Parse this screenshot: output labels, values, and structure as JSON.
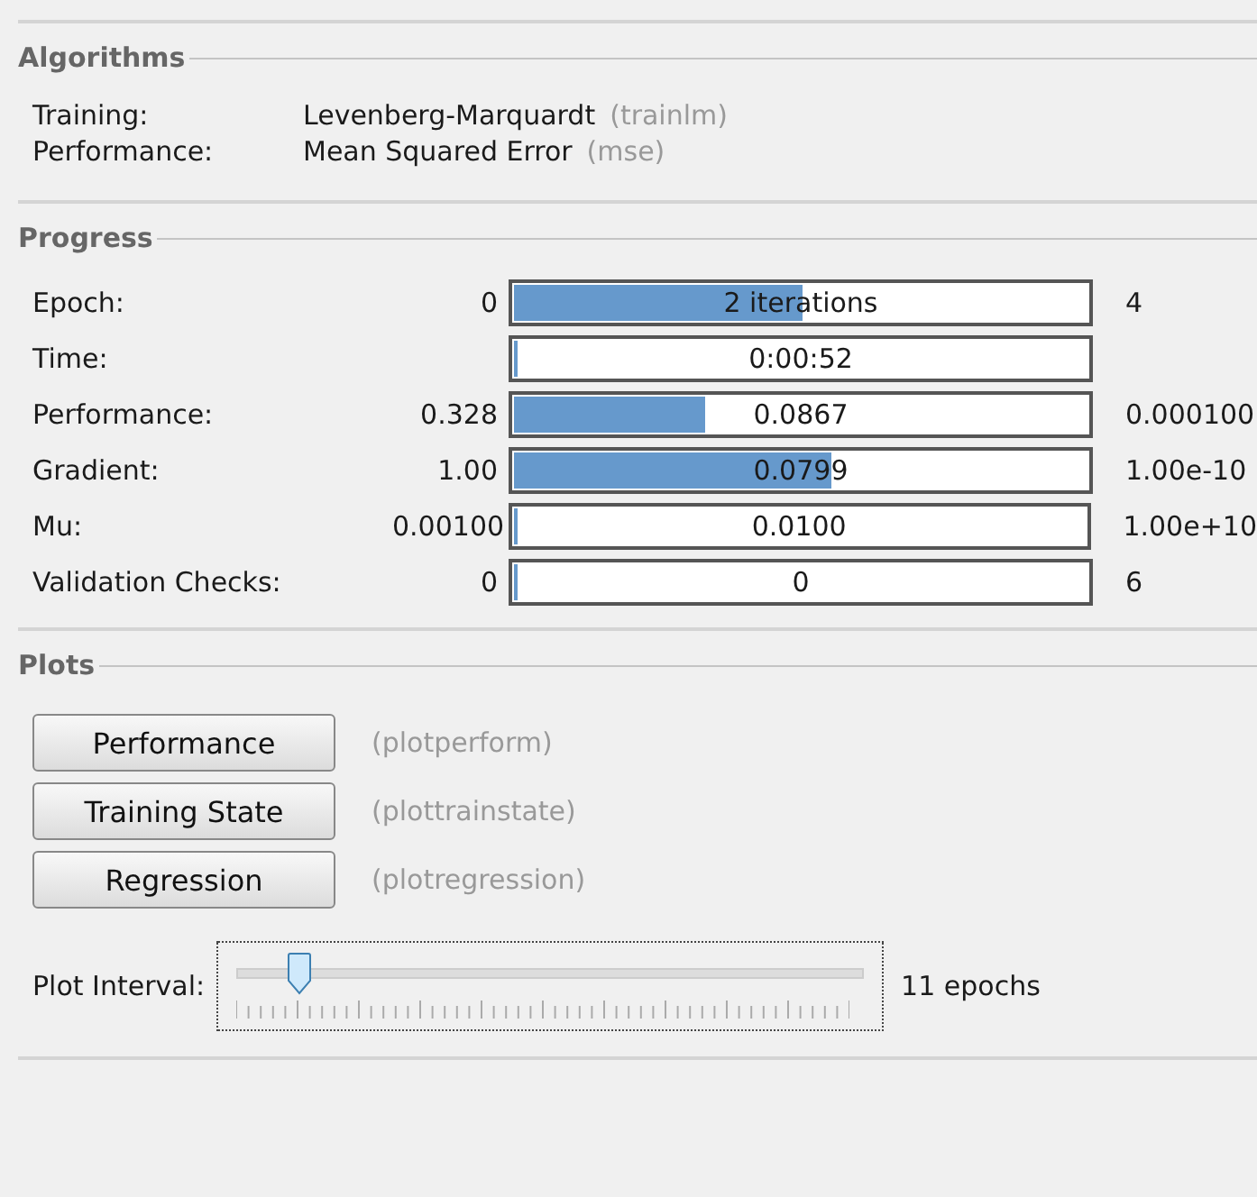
{
  "algorithms": {
    "title": "Algorithms",
    "rows": [
      {
        "label": "Training:",
        "value": "Levenberg-Marquardt",
        "code": "(trainlm)"
      },
      {
        "label": "Performance:",
        "value": "Mean Squared Error",
        "code": "(mse)"
      }
    ]
  },
  "progress": {
    "title": "Progress",
    "rows": [
      {
        "label": "Epoch:",
        "start": "0",
        "reading": "2 iterations",
        "level": 0.5,
        "target": "4"
      },
      {
        "label": "Time:",
        "reading": "0:00:52",
        "level": 0
      },
      {
        "label": "Performance:",
        "start": "0.328",
        "reading": "0.0867",
        "level": 0.33,
        "target": "0.000100"
      },
      {
        "label": "Gradient:",
        "start": "1.00",
        "reading": "0.0799",
        "level": 0.55,
        "target": "1.00e-10"
      },
      {
        "label": "Mu:",
        "start": "0.00100",
        "reading": "0.0100",
        "level": 0,
        "target": "1.00e+10"
      },
      {
        "label": "Validation Checks:",
        "start": "0",
        "reading": "0",
        "level": 0,
        "target": "6"
      }
    ]
  },
  "plots": {
    "title": "Plots",
    "buttons": [
      {
        "label": "Performance",
        "code": "(plotperform)"
      },
      {
        "label": "Training State",
        "code": "(plottrainstate)"
      },
      {
        "label": "Regression",
        "code": "(plotregression)"
      }
    ],
    "interval": {
      "label": "Plot Interval:",
      "level": 0.1,
      "reading": "11 epochs"
    }
  }
}
